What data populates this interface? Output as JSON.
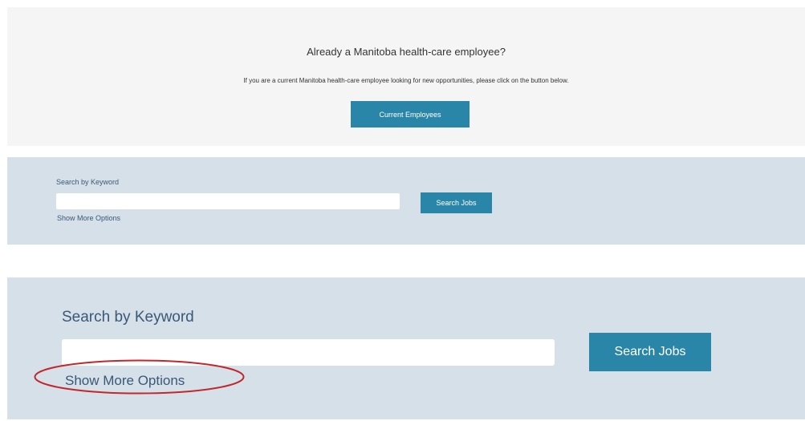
{
  "banner": {
    "heading": "Already a Manitoba health-care employee?",
    "text": "If you are a current Manitoba health-care employee looking for new opportunities, please click on the button below.",
    "button_label": "Current Employees"
  },
  "search_small": {
    "label": "Search by Keyword",
    "input_value": "",
    "button_label": "Search Jobs",
    "more_options": "Show More Options"
  },
  "search_large": {
    "label": "Search by Keyword",
    "input_value": "",
    "button_label": "Search Jobs",
    "more_options": "Show More Options"
  },
  "colors": {
    "button": "#2a86a8",
    "panel": "#d6e0e8",
    "banner": "#f5f5f5",
    "link": "#3b5878",
    "highlight": "#c0282d"
  }
}
